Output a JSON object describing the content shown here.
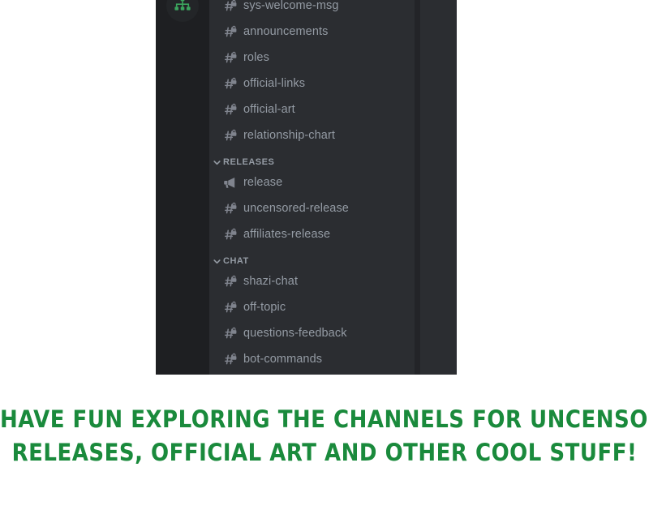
{
  "screenshot": {
    "app": "Discord",
    "server_icon": "hierarchy-icon",
    "channel_list": [
      {
        "kind": "channel",
        "icon": "hash-locked-icon",
        "label": "sys-welcome-msg"
      },
      {
        "kind": "channel",
        "icon": "hash-locked-icon",
        "label": "announcements"
      },
      {
        "kind": "channel",
        "icon": "hash-locked-icon",
        "label": "roles"
      },
      {
        "kind": "channel",
        "icon": "hash-locked-icon",
        "label": "official-links"
      },
      {
        "kind": "channel",
        "icon": "hash-locked-icon",
        "label": "official-art"
      },
      {
        "kind": "channel",
        "icon": "hash-locked-icon",
        "label": "relationship-chart"
      },
      {
        "kind": "category",
        "icon": "chevron-down-icon",
        "label": "RELEASES"
      },
      {
        "kind": "channel",
        "icon": "megaphone-icon",
        "label": "release"
      },
      {
        "kind": "channel",
        "icon": "hash-locked-icon",
        "label": "uncensored-release"
      },
      {
        "kind": "channel",
        "icon": "hash-locked-icon",
        "label": "affiliates-release"
      },
      {
        "kind": "category",
        "icon": "chevron-down-icon",
        "label": "CHAT"
      },
      {
        "kind": "channel",
        "icon": "hash-locked-icon",
        "label": "shazi-chat"
      },
      {
        "kind": "channel",
        "icon": "hash-locked-icon",
        "label": "off-topic"
      },
      {
        "kind": "channel",
        "icon": "hash-locked-icon",
        "label": "questions-feedback"
      },
      {
        "kind": "channel",
        "icon": "hash-locked-icon",
        "label": "bot-commands"
      }
    ],
    "colors": {
      "server_rail_bg": "#1e1f22",
      "channel_bg": "#2b2d31",
      "channel_text": "#949ba4",
      "server_icon_accent": "#3ba55d",
      "scrollbar_track": "#232428"
    }
  },
  "caption": {
    "lines": [
      "HAVE FUN EXPLORING THE CHANNELS FOR UNCENSORED",
      "RELEASES, OFFICIAL ART AND OTHER COOL STUFF!"
    ],
    "color": "#1a8a3c"
  }
}
